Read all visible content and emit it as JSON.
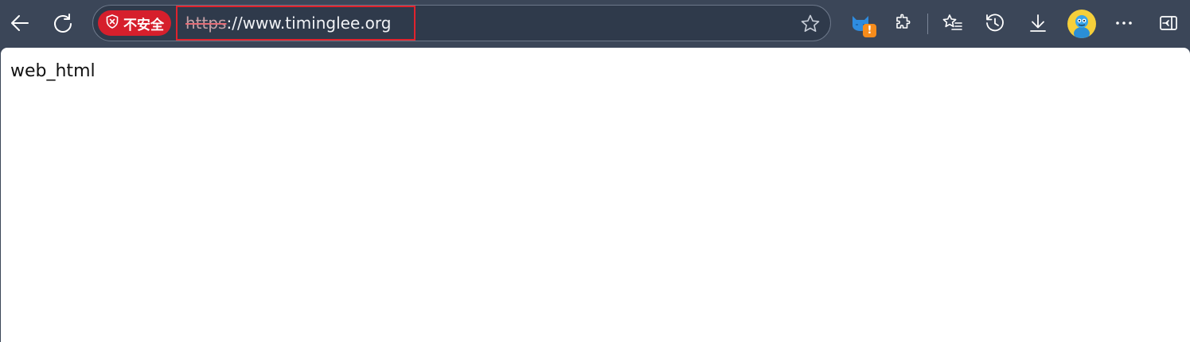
{
  "toolbar": {
    "back_icon": "back-arrow-icon",
    "refresh_icon": "refresh-icon",
    "extensions_icon": "puzzle-icon",
    "favorites_icon": "favorites-list-icon",
    "history_icon": "history-icon",
    "downloads_icon": "download-icon",
    "more_icon": "more-dots-icon",
    "sidebar_icon": "sidebar-toggle-icon"
  },
  "address_bar": {
    "security_label": "不安全",
    "url_protocol": "https",
    "url_rest": "://www.timinglee.org",
    "favorite_icon": "star-icon"
  },
  "extension": {
    "badge": "!"
  },
  "page": {
    "text": "web_html"
  },
  "colors": {
    "toolbar_bg": "#3b4658",
    "security_badge": "#d61f2c",
    "highlight_border": "#e0232d",
    "extension_badge": "#f78c1b",
    "avatar_bg": "#f5cf3a"
  }
}
